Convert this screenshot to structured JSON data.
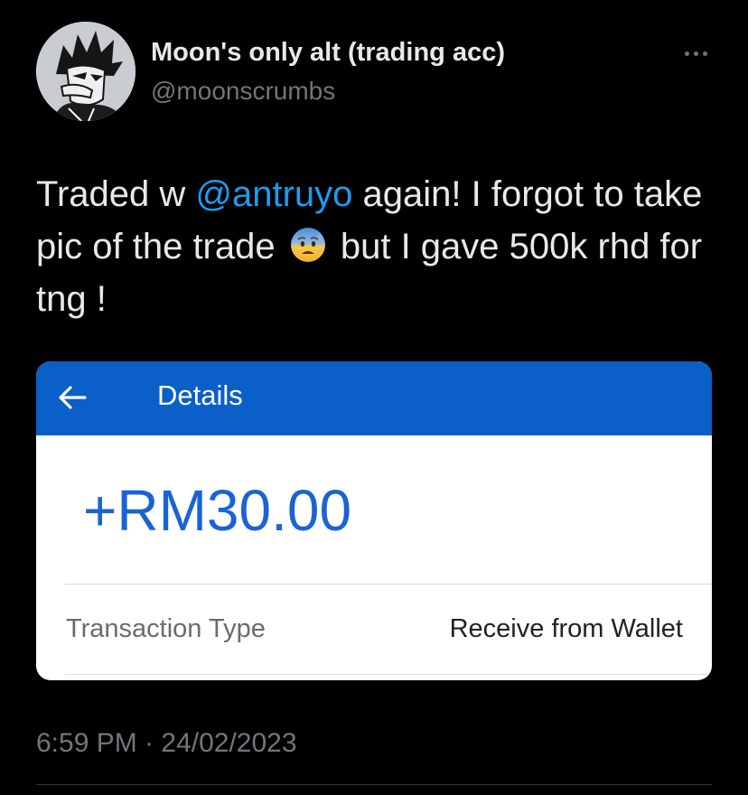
{
  "tweet": {
    "author": {
      "display_name": "Moon's only alt (trading acc)",
      "handle": "@moonscrumbs",
      "avatar_icon": "anime-avatar"
    },
    "more_icon": "more-options-icon",
    "text": {
      "part1": "Traded w ",
      "mention": "@antruyo",
      "part2": " again! I forgot to take pic of the trade ",
      "emoji": "anxious-face-with-sweat",
      "part3": " but I gave 500k rhd for tng !"
    },
    "timestamp": "6:59 PM · 24/02/2023"
  },
  "attachment": {
    "header": {
      "back_icon": "back-arrow-icon",
      "title": "Details"
    },
    "amount": "+RM30.00",
    "rows": [
      {
        "label": "Transaction Type",
        "value": "Receive from Wallet"
      }
    ]
  },
  "colors": {
    "background": "#000000",
    "mention": "#1d9bf0",
    "header_blue": "#0a5fc8",
    "amount_blue": "#1a63d6",
    "secondary_text": "#71767b"
  }
}
